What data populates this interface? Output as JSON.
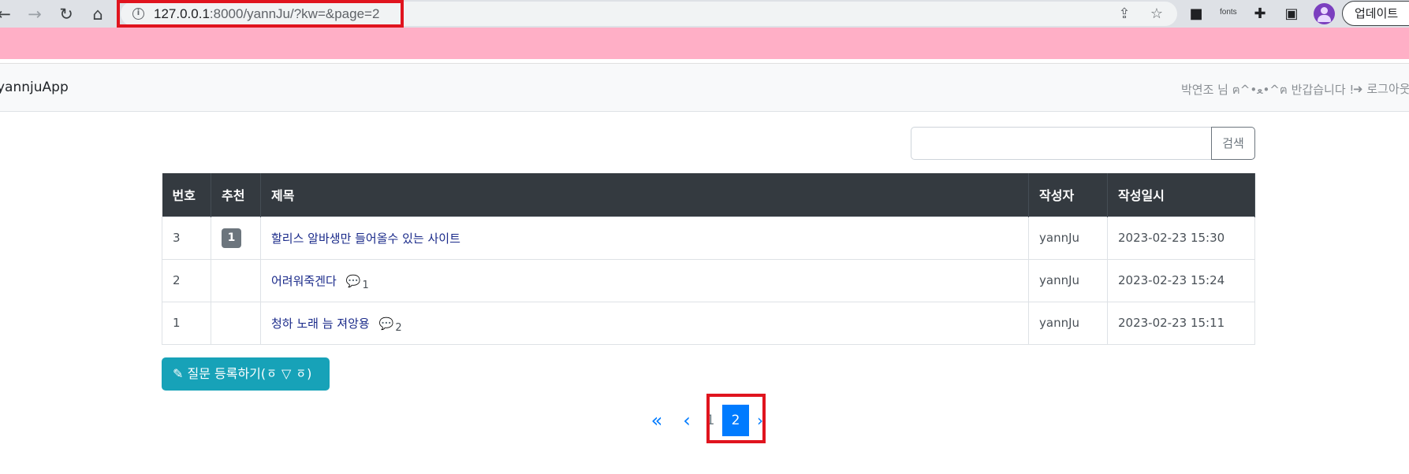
{
  "browser": {
    "url_host": "127.0.0.1",
    "url_rest": ":8000/yannJu/?kw=&page=2",
    "fonts_ext_label": "fonts",
    "update_button": "업데이트"
  },
  "navbar": {
    "brand": "yannjuApp",
    "greeting": "박연조 님 ฅ^•ﻌ•^ฅ 반갑습니다 !",
    "logout": "로그아웃"
  },
  "search": {
    "placeholder": "",
    "button_label": "검색"
  },
  "table": {
    "headers": [
      "번호",
      "추천",
      "제목",
      "작성자",
      "작성일시"
    ],
    "rows": [
      {
        "no": "3",
        "recommend": "1",
        "subject": "할리스 알바생만 들어올수 있는 사이트",
        "comments": "",
        "author": "yannJu",
        "date": "2023-02-23 15:30"
      },
      {
        "no": "2",
        "recommend": "",
        "subject": "어려워죽겐다",
        "comments": "1",
        "author": "yannJu",
        "date": "2023-02-23 15:24"
      },
      {
        "no": "1",
        "recommend": "",
        "subject": "청하 노래 늠 져앙용",
        "comments": "2",
        "author": "yannJu",
        "date": "2023-02-23 15:11"
      }
    ]
  },
  "register_button": "질문 등록하기(ㆆ ▽ ㆆ)",
  "pagination": {
    "first": "«",
    "prev": "‹",
    "pages": [
      "1",
      "2"
    ],
    "current": "2",
    "next": "›"
  },
  "colors": {
    "pink_bar": "#ffafc6",
    "table_header": "#343a40",
    "primary": "#007bff",
    "info": "#17a2b8",
    "highlight_box": "#e0141e"
  }
}
